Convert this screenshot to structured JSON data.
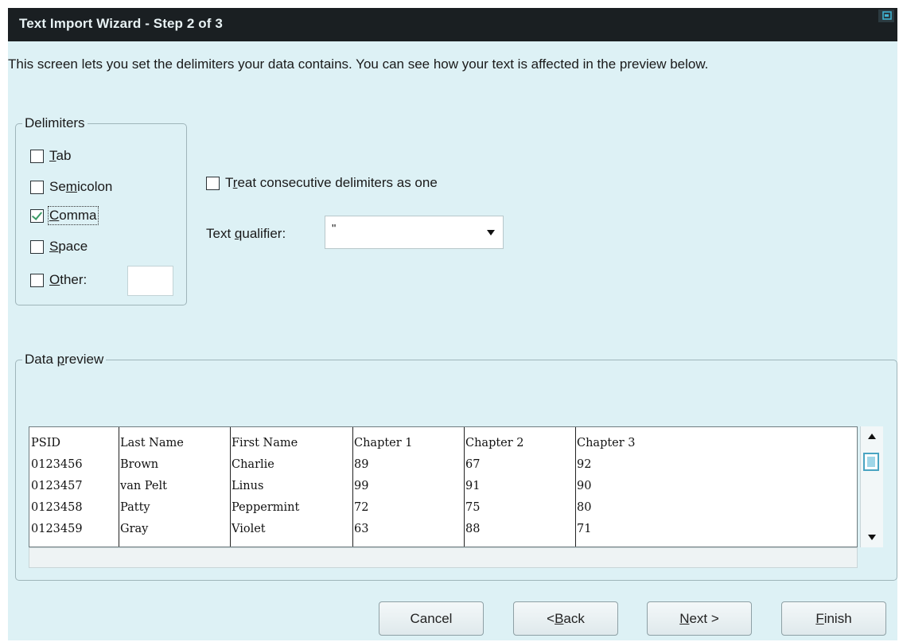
{
  "window": {
    "title": "Text Import Wizard - Step 2 of 3"
  },
  "intro_text": "This screen lets you set the delimiters your data contains.  You can see how your text is affected in the preview below.",
  "delimiters": {
    "legend": "Delimiters",
    "options": [
      {
        "pre": "",
        "key": "T",
        "post": "ab",
        "checked": false
      },
      {
        "pre": "Se",
        "key": "m",
        "post": "icolon",
        "checked": false
      },
      {
        "pre": "",
        "key": "C",
        "post": "omma",
        "checked": true
      },
      {
        "pre": "",
        "key": "S",
        "post": "pace",
        "checked": false
      },
      {
        "pre": "",
        "key": "O",
        "post": "ther:",
        "checked": false
      }
    ],
    "other_value": ""
  },
  "consecutive": {
    "pre": "T",
    "key": "r",
    "post": "eat consecutive delimiters as one",
    "checked": false
  },
  "qualifier": {
    "label_pre": "Text ",
    "label_key": "q",
    "label_post": "ualifier:",
    "value": "\""
  },
  "preview": {
    "legend_pre": "Data ",
    "legend_key": "p",
    "legend_post": "review",
    "rows": [
      [
        "PSID",
        "Last Name",
        "First Name",
        "Chapter 1",
        "Chapter 2",
        "Chapter 3"
      ],
      [
        "0123456",
        "Brown",
        "Charlie",
        "89",
        "67",
        "92"
      ],
      [
        "0123457",
        "van Pelt",
        "Linus",
        "99",
        "91",
        "90"
      ],
      [
        "0123458",
        "Patty",
        "Peppermint",
        "72",
        "75",
        "80"
      ],
      [
        "0123459",
        "Gray",
        "Violet",
        "63",
        "88",
        "71"
      ]
    ]
  },
  "buttons": {
    "cancel": "Cancel",
    "back_pre": "< ",
    "back_key": "B",
    "back_post": "ack",
    "next_key": "N",
    "next_post": "ext >",
    "finish_key": "F",
    "finish_post": "inish"
  },
  "colors": {
    "titlebar": "#1a1f22",
    "dialog_bg": "#ddf1f5",
    "check_mark": "#3a9a66"
  }
}
